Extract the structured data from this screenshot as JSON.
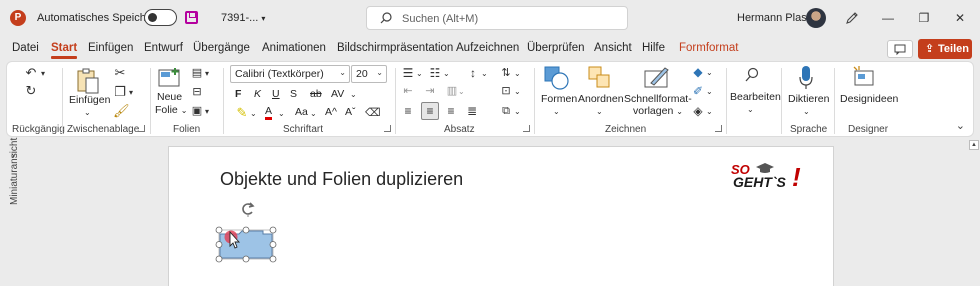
{
  "titlebar": {
    "app_logo": "P",
    "autosave_label": "Automatisches Speichern",
    "autosave_state": "off",
    "doc_name": "7391-...",
    "search_placeholder": "Suchen (Alt+M)",
    "user_name": "Hermann Plasa",
    "minimize_glyph": "—",
    "restore_glyph": "❐",
    "close_glyph": "✕"
  },
  "tabs": [
    "Datei",
    "Start",
    "Einfügen",
    "Entwurf",
    "Übergänge",
    "Animationen",
    "Bildschirmpräsentation",
    "Aufzeichnen",
    "Überprüfen",
    "Ansicht",
    "Hilfe",
    "Formformat"
  ],
  "active_tab": "Start",
  "share_label": "Teilen",
  "ribbon": {
    "groups": {
      "rueckgaengig": "Rückgängig",
      "zwischenablage": "Zwischenablage",
      "folien": "Folien",
      "schriftart": "Schriftart",
      "absatz": "Absatz",
      "zeichnen": "Zeichnen",
      "sprache": "Sprache",
      "designer": "Designer"
    },
    "buttons": {
      "einfuegen": "Einfügen",
      "neue_folie_1": "Neue",
      "neue_folie_2": "Folie",
      "formen": "Formen",
      "anordnen": "Anordnen",
      "schnellformat_1": "Schnellformat-",
      "schnellformat_2": "vorlagen",
      "bearbeiten": "Bearbeiten",
      "diktieren": "Diktieren",
      "designideen": "Designideen"
    },
    "font_name": "Calibri (Textkörper)",
    "font_size": "20",
    "font_buttons": {
      "bold": "F",
      "italic": "K",
      "underline": "U",
      "shadow": "S",
      "strike": "ab",
      "spacing": "AV",
      "case": "Aa",
      "grow": "A^",
      "shrink": "Aˇ"
    }
  },
  "thumbnail_label": "Miniaturansicht",
  "slide": {
    "title": "Objekte und Folien duplizieren",
    "logo_line1": "SO",
    "logo_line2": "GEHT`S",
    "logo_bang": "!"
  }
}
